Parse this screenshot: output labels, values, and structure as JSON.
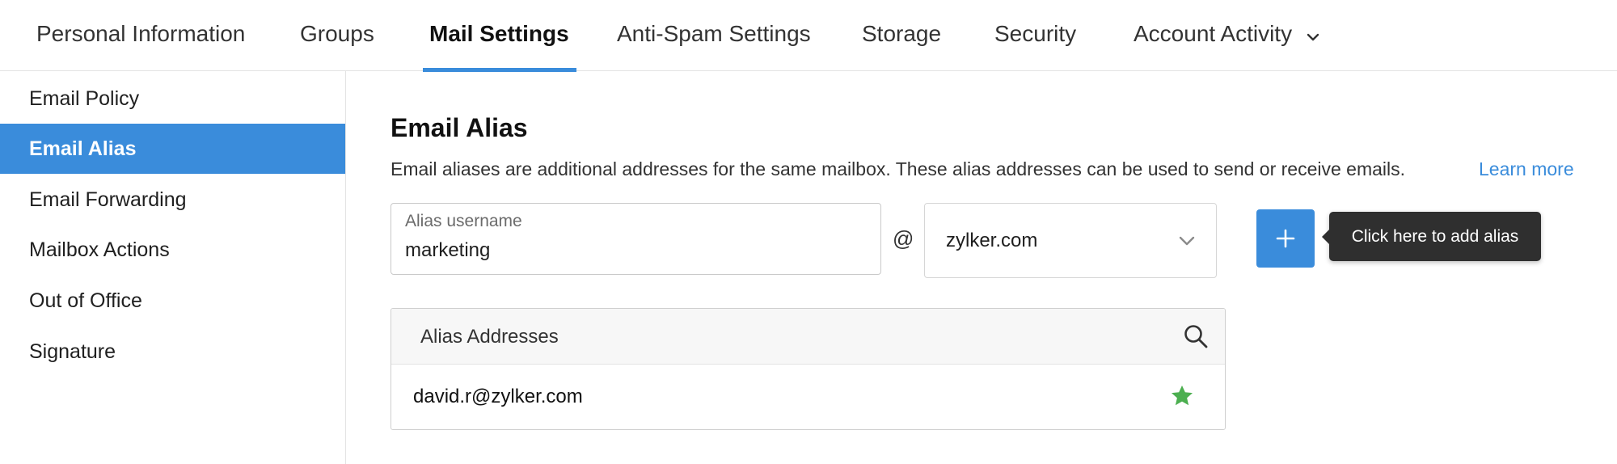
{
  "tabs": [
    {
      "label": "Personal Information"
    },
    {
      "label": "Groups"
    },
    {
      "label": "Mail Settings",
      "active": true
    },
    {
      "label": "Anti-Spam Settings"
    },
    {
      "label": "Storage"
    },
    {
      "label": "Security"
    },
    {
      "label": "Account Activity",
      "icon": "chevron-down-icon"
    }
  ],
  "sidebar": {
    "items": [
      {
        "label": "Email Policy"
      },
      {
        "label": "Email Alias",
        "active": true
      },
      {
        "label": "Email Forwarding"
      },
      {
        "label": "Mailbox Actions"
      },
      {
        "label": "Out of Office"
      },
      {
        "label": "Signature"
      }
    ]
  },
  "main": {
    "title": "Email Alias",
    "description": "Email aliases are additional addresses for the same mailbox. These alias addresses can be used to send or receive emails.",
    "learn_more": "Learn more",
    "alias_field": {
      "label": "Alias username",
      "value": "marketing"
    },
    "at_sign": "@",
    "domain_select": {
      "value": "zylker.com",
      "icon": "chevron-down-icon"
    },
    "add_button": {
      "icon": "plus-icon"
    },
    "tooltip": "Click here to add alias",
    "alias_table": {
      "title": "Alias Addresses",
      "search_icon": "search-icon",
      "rows": [
        {
          "email": "david.r@zylker.com",
          "icon": "star-icon",
          "icon_color": "#4caf50"
        }
      ]
    }
  },
  "colors": {
    "accent": "#3a8cdb",
    "tooltip_bg": "#2f2f2f",
    "star": "#4caf50"
  }
}
